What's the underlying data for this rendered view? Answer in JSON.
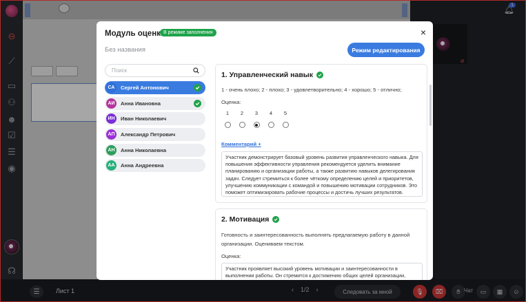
{
  "modal": {
    "title": "Модуль оценки",
    "mode_badge": "В режиме заполнения",
    "subtitle": "Без названия",
    "edit_button": "Режим редактирования",
    "close": "×",
    "search_placeholder": "Поиск"
  },
  "people": [
    {
      "initials": "СА",
      "name": "Сергей Антонович",
      "color": "#2f6fd8",
      "done": true,
      "active": true
    },
    {
      "initials": "АИ",
      "name": "Анна Ивановна",
      "color": "#b5359d",
      "done": true,
      "active": false
    },
    {
      "initials": "ИН",
      "name": "Иван Николаевич",
      "color": "#7b2fd8",
      "done": false,
      "active": false
    },
    {
      "initials": "АП",
      "name": "Александр Петрович",
      "color": "#9b2fd8",
      "done": false,
      "active": false
    },
    {
      "initials": "АН",
      "name": "Анна Николаевна",
      "color": "#2f9e5c",
      "done": false,
      "active": false
    },
    {
      "initials": "АА",
      "name": "Анна Андреевна",
      "color": "#27b07a",
      "done": false,
      "active": false
    }
  ],
  "questions": [
    {
      "title": "1. Управленческий навык",
      "scale_desc": "1 - очень плохо; 2 - плохо; 3 - удовлетворительно; 4 - хорошо; 5 - отлично;",
      "score_label": "Оценка:",
      "scale": [
        "1",
        "2",
        "3",
        "4",
        "5"
      ],
      "selected": 3,
      "comment_link": "Комментарий +",
      "comment": "Участник демонстрирует базовый уровень развития управленческого навыка. Для повышения эффективности управления рекомендуется уделить внимание планированию и организации работы, а также развитию навыков делегирования задач. Следует стремиться к более чёткому определению целей и приоритетов, улучшению коммуникации с командой и повышению мотивации сотрудников. Это поможет оптимизировать рабочие процессы и достичь лучших результатов."
    },
    {
      "title": "2. Мотивация",
      "desc": "Готовность и заинтересованность выполнять предлагаемую работу в данной организации. Оцениваем текстом.",
      "score_label": "Оценка:",
      "comment": "Участник проявляет высокий уровень мотивации и заинтересованности в выполнении работы. Он стремится к достижению общих целей организации, активно участвует в обсуждениях и предлагает свои идеи. Это способствует"
    }
  ],
  "bottom": {
    "sheet": "Лист 1",
    "pager": "1/2",
    "follow": "Следовать за мной",
    "chat": "Чат"
  },
  "notifications": {
    "count": "1"
  }
}
